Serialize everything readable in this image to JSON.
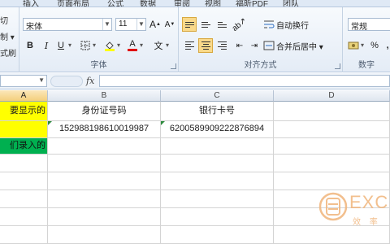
{
  "tabs": [
    "插入",
    "页面布局",
    "公式",
    "数据",
    "审阅",
    "视图",
    "福昕PDF",
    "团队"
  ],
  "clipboard": {
    "items": [
      "切",
      "制 ▾",
      "式刷"
    ]
  },
  "font": {
    "name": "宋体",
    "size": "11",
    "group_label": "字体",
    "grow_label": "A",
    "shrink_label": "A",
    "bold": "B",
    "italic": "I",
    "underline": "U",
    "font_color_label": "A",
    "wen": "文"
  },
  "alignment": {
    "group_label": "对齐方式",
    "wrap_label": "自动换行",
    "merge_label": "合并后居中 ▾"
  },
  "number": {
    "group_label": "数字",
    "format": "常规",
    "percent": "%",
    "comma": ","
  },
  "formula_bar": {
    "fx": "fx"
  },
  "columns": [
    "A",
    "B",
    "C",
    "D"
  ],
  "rows": [
    [
      "要显示的",
      "身份证号码",
      "银行卡号",
      ""
    ],
    [
      "",
      "152988198610019987",
      "6200589909222876894",
      ""
    ],
    [
      "们录入的",
      "",
      "",
      ""
    ]
  ],
  "watermark": {
    "text": "EXC",
    "sub": "效 率"
  }
}
